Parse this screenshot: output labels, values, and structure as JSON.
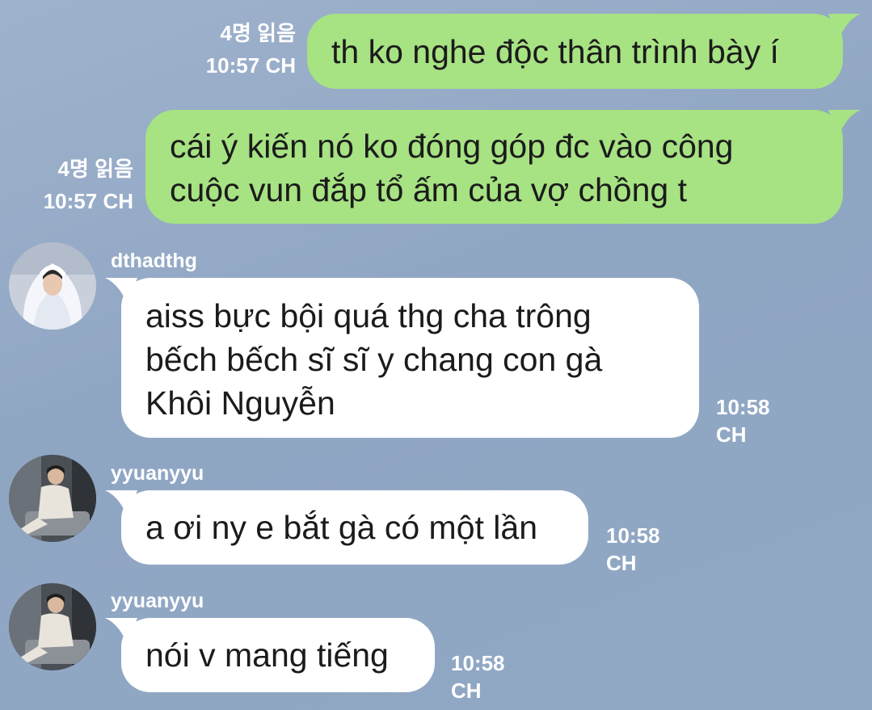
{
  "messages": [
    {
      "direction": "outgoing",
      "text": "th ko nghe độc thân trình bày í",
      "read_receipt": "4명 읽음",
      "time": "10:57 CH"
    },
    {
      "direction": "outgoing",
      "text": "cái ý kiến nó ko đóng góp đc vào công\ncuộc vun đắp tổ ấm của vợ chồng t",
      "read_receipt": "4명 읽음",
      "time": "10:57 CH"
    },
    {
      "direction": "incoming",
      "sender": "dthadthg",
      "text": "aiss bực bội quá thg cha trông\nbếch bếch sĩ sĩ y chang con gà\nKhôi Nguyễn",
      "time": "10:58 CH"
    },
    {
      "direction": "incoming",
      "sender": "yyuanyyu",
      "text": "a ơi ny e bắt gà có một lần",
      "time": "10:58 CH"
    },
    {
      "direction": "incoming",
      "sender": "yyuanyyu",
      "text": "nói v mang tiếng",
      "time": "10:58 CH"
    }
  ],
  "colors": {
    "background": "#93a9c6",
    "outgoing_bubble": "#a7e283",
    "incoming_bubble": "#ffffff",
    "meta_text": "#ffffff"
  },
  "icons": [
    "avatar-dthadthg",
    "avatar-yyuanyyu"
  ]
}
